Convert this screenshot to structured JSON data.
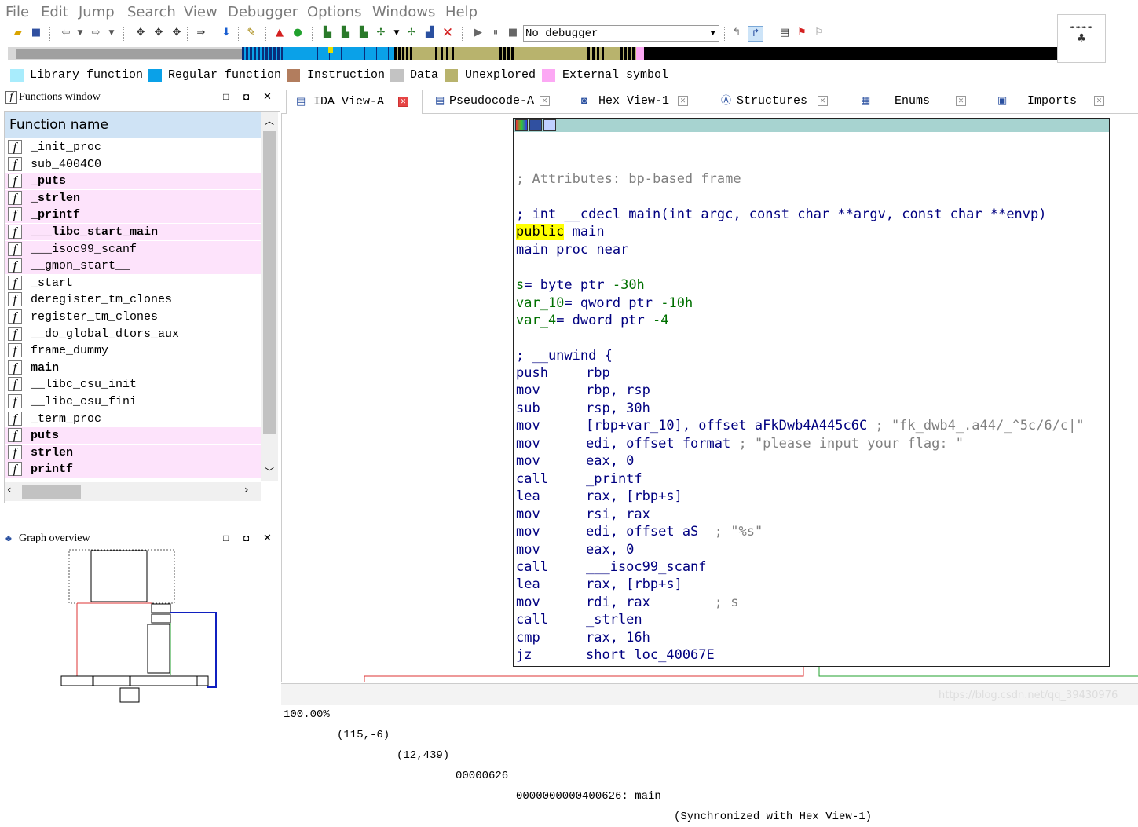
{
  "menu": [
    "File",
    "Edit",
    "Jump",
    "Search",
    "View",
    "Debugger",
    "Options",
    "Windows",
    "Help"
  ],
  "toolbar": {
    "debugger_value": "No debugger"
  },
  "legend": [
    {
      "label": "Library function",
      "color": "#a8ecfc"
    },
    {
      "label": "Regular function",
      "color": "#0aa1e8"
    },
    {
      "label": "Instruction",
      "color": "#b27d5e"
    },
    {
      "label": "Data",
      "color": "#c3c3c3"
    },
    {
      "label": "Unexplored",
      "color": "#b8b36d"
    },
    {
      "label": "External symbol",
      "color": "#fca8f4"
    }
  ],
  "functions_window": {
    "title": "Functions window",
    "header": "Function name",
    "functions": [
      {
        "name": "_init_proc",
        "pink": false,
        "bold": false
      },
      {
        "name": "sub_4004C0",
        "pink": false,
        "bold": false
      },
      {
        "name": "_puts",
        "pink": true,
        "bold": true
      },
      {
        "name": "_strlen",
        "pink": true,
        "bold": true
      },
      {
        "name": "_printf",
        "pink": true,
        "bold": true
      },
      {
        "name": "___libc_start_main",
        "pink": true,
        "bold": true
      },
      {
        "name": "___isoc99_scanf",
        "pink": true,
        "bold": false
      },
      {
        "name": "__gmon_start__",
        "pink": true,
        "bold": false
      },
      {
        "name": "_start",
        "pink": false,
        "bold": false
      },
      {
        "name": "deregister_tm_clones",
        "pink": false,
        "bold": false
      },
      {
        "name": "register_tm_clones",
        "pink": false,
        "bold": false
      },
      {
        "name": "__do_global_dtors_aux",
        "pink": false,
        "bold": false
      },
      {
        "name": "frame_dummy",
        "pink": false,
        "bold": false
      },
      {
        "name": "main",
        "pink": false,
        "bold": true
      },
      {
        "name": "__libc_csu_init",
        "pink": false,
        "bold": false
      },
      {
        "name": "__libc_csu_fini",
        "pink": false,
        "bold": false
      },
      {
        "name": "_term_proc",
        "pink": false,
        "bold": false
      },
      {
        "name": "puts",
        "pink": true,
        "bold": true
      },
      {
        "name": "strlen",
        "pink": true,
        "bold": true
      },
      {
        "name": "printf",
        "pink": true,
        "bold": true
      }
    ]
  },
  "graph_overview": {
    "title": "Graph overview"
  },
  "tabs": [
    {
      "label": "IDA View-A",
      "active": true
    },
    {
      "label": "Pseudocode-A",
      "active": false
    },
    {
      "label": "Hex View-1",
      "active": false
    },
    {
      "label": "Structures",
      "active": false
    },
    {
      "label": "Enums",
      "active": false
    },
    {
      "label": "Imports",
      "active": false
    }
  ],
  "disasm": {
    "attributes": "; Attributes: bp-based frame",
    "signature": "; int __cdecl main(int argc, const char **argv, const char **envp)",
    "public_kw": "public",
    "public_name": " main",
    "proc_line": "main proc near",
    "vars": [
      {
        "name": "s",
        "rest": "= byte ptr ",
        "val": "-30h"
      },
      {
        "name": "var_10",
        "rest": "= qword ptr ",
        "val": "-10h"
      },
      {
        "name": "var_4",
        "rest": "= dword ptr ",
        "val": "-4"
      }
    ],
    "unwind": "; __unwind {",
    "instructions": [
      {
        "mn": "push",
        "op": "rbp",
        "cm": ""
      },
      {
        "mn": "mov",
        "op": "rbp, rsp",
        "cm": ""
      },
      {
        "mn": "sub",
        "op": "rsp, 30h",
        "cm": ""
      },
      {
        "mn": "mov",
        "op": "[rbp+var_10], offset aFkDwb4A445c6C",
        "cm": " ; \"fk_dwb4_.a44/_^5c/6/c|\""
      },
      {
        "mn": "mov",
        "op": "edi, offset format",
        "cm": " ; \"please input your flag: \""
      },
      {
        "mn": "mov",
        "op": "eax, 0",
        "cm": ""
      },
      {
        "mn": "call",
        "op": "_printf",
        "cm": ""
      },
      {
        "mn": "lea",
        "op": "rax, [rbp+s]",
        "cm": ""
      },
      {
        "mn": "mov",
        "op": "rsi, rax",
        "cm": ""
      },
      {
        "mn": "mov",
        "op": "edi, offset aS",
        "cm": "  ; \"%s\""
      },
      {
        "mn": "mov",
        "op": "eax, 0",
        "cm": ""
      },
      {
        "mn": "call",
        "op": "___isoc99_scanf",
        "cm": ""
      },
      {
        "mn": "lea",
        "op": "rax, [rbp+s]",
        "cm": ""
      },
      {
        "mn": "mov",
        "op": "rdi, rax",
        "cm": "        ; s"
      },
      {
        "mn": "call",
        "op": "_strlen",
        "cm": ""
      },
      {
        "mn": "cmp",
        "op": "rax, 16h",
        "cm": ""
      },
      {
        "mn": "jz",
        "op": "short loc_40067E",
        "cm": ""
      }
    ]
  },
  "status": {
    "zoom": "100.00%",
    "pos1": "(115,-6)",
    "pos2": "(12,439)",
    "offset": "00000626",
    "address": "0000000000400626: main",
    "sync": "(Synchronized with Hex View-1)"
  },
  "watermark": "https://blog.csdn.net/qq_39430976"
}
